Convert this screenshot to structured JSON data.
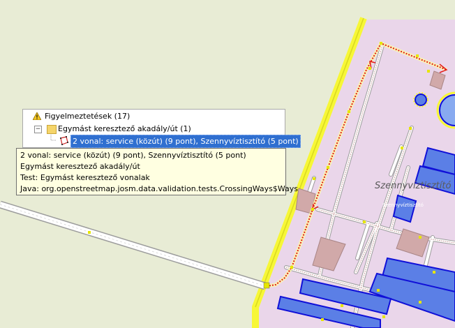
{
  "validator_tree": {
    "root": {
      "label": "Figyelmeztetések (17)",
      "icon": "warning-icon"
    },
    "group": {
      "label": "Egymást keresztező akadály/út (1)",
      "icon": "folder-icon"
    },
    "item": {
      "label": "2 vonal: service (közút) (9 pont), Szennyvíztisztító (5 pont)",
      "icon": "way-icon"
    },
    "expander_symbol": "−"
  },
  "tooltip": {
    "line1": "2 vonal: service (közút) (9 pont), Szennyvíztisztító (5 pont)",
    "line2": "Egymást keresztező akadály/út",
    "line3": "Test: Egymást keresztező vonalak",
    "line4": "Java: org.openstreetmap.josm.data.validation.tests.CrossingWays$Ways"
  },
  "map": {
    "area_label": "Szennyvíztisztító",
    "area_label_small": "Szennyvíztisztító",
    "colors": {
      "background": "#e8ecd5",
      "landuse_fill": "#ead6ea",
      "boundary": "#f7f736",
      "building": "#5b7fe6",
      "building_outline": "#1010d8",
      "selected_way": "#e21a1a",
      "highlight": "#ffffa0"
    }
  }
}
